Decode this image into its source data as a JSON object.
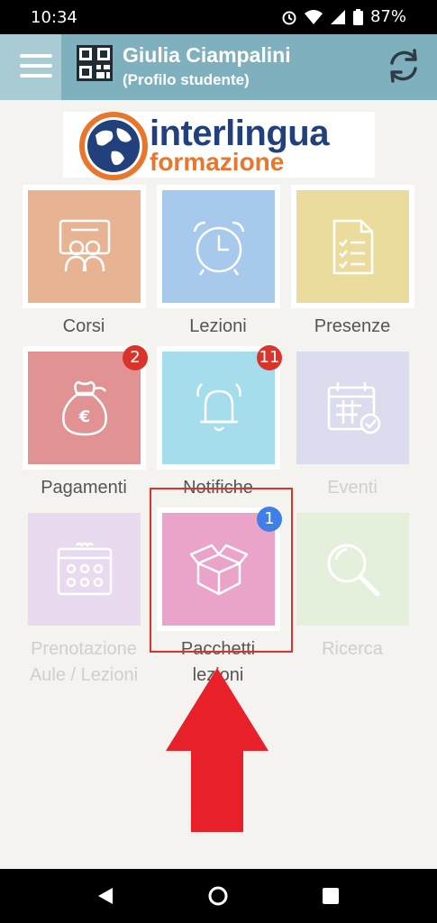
{
  "status": {
    "time": "10:34",
    "battery": "87%"
  },
  "header": {
    "user_name": "Giulia Ciampalini",
    "role": "(Profilo studente)"
  },
  "logo": {
    "line1": "interlingua",
    "line2": "formazione"
  },
  "colors": {
    "header": "#7eb0bd",
    "badge_red": "#d9342b",
    "badge_blue": "#3f7fe6",
    "arrow": "#e8202a"
  },
  "tiles": [
    {
      "label": "Corsi",
      "icon": "classroom-icon",
      "color": "#e8b393"
    },
    {
      "label": "Lezioni",
      "icon": "alarm-clock-icon",
      "color": "#a7c9ec"
    },
    {
      "label": "Presenze",
      "icon": "checklist-document-icon",
      "color": "#ebdc9d"
    },
    {
      "label": "Pagamenti",
      "icon": "money-bag-euro-icon",
      "color": "#e19393",
      "badge": "2"
    },
    {
      "label": "Notifiche",
      "icon": "bell-icon",
      "color": "#a6ddec",
      "badge": "11"
    },
    {
      "label": "Eventi",
      "icon": "calendar-check-icon",
      "color": "#dcdcef"
    },
    {
      "label": "Prenotazione Aule / Lezioni",
      "line1": "Prenotazione",
      "line2": "Aule / Lezioni",
      "icon": "calendar-grid-icon",
      "color": "#e8daef"
    },
    {
      "label": "Pacchetti lezioni",
      "line1": "Pacchetti",
      "line2": "lezioni",
      "icon": "package-box-icon",
      "color": "#eba4c9",
      "badge": "1"
    },
    {
      "label": "Ricerca",
      "icon": "magnifier-icon",
      "color": "#e5f0dc"
    }
  ]
}
